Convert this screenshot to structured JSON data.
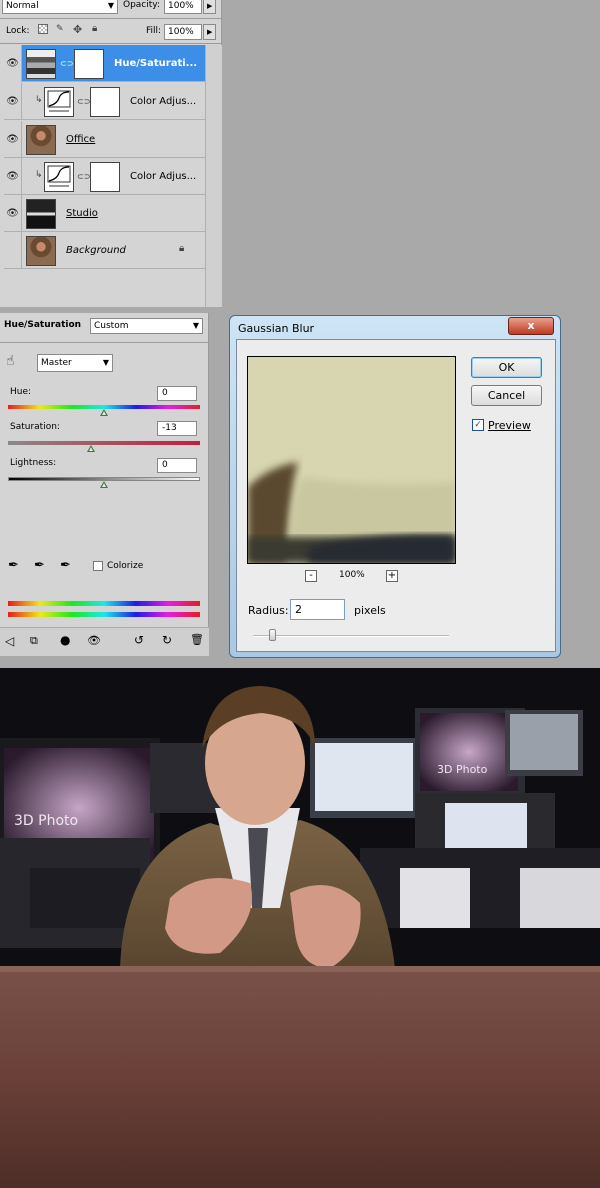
{
  "layers_panel": {
    "blend_mode": "Normal",
    "opacity_label": "Opacity:",
    "opacity_value": "100%",
    "lock_label": "Lock:",
    "fill_label": "Fill:",
    "fill_value": "100%",
    "layers": [
      {
        "name": "Hue/Saturati...",
        "selected": true
      },
      {
        "name": "Color Adjus..."
      },
      {
        "name": "Office"
      },
      {
        "name": "Color Adjus..."
      },
      {
        "name": "Studio"
      },
      {
        "name": "Background"
      }
    ]
  },
  "adjustments": {
    "title": "Hue/Saturation",
    "preset": "Custom",
    "channel": "Master",
    "hue_label": "Hue:",
    "hue_value": "0",
    "saturation_label": "Saturation:",
    "saturation_value": "-13",
    "lightness_label": "Lightness:",
    "lightness_value": "0",
    "colorize_label": "Colorize"
  },
  "gaussian_blur": {
    "title": "Gaussian Blur",
    "ok_label": "OK",
    "cancel_label": "Cancel",
    "preview_label": "Preview",
    "preview_checked": true,
    "zoom_minus": "-",
    "zoom_value": "100%",
    "zoom_plus": "+",
    "radius_label": "Radius:",
    "radius_value": "2",
    "radius_unit": "pixels",
    "close_glyph": "x"
  },
  "photo": {
    "screen_text_left": "3D Photo",
    "screen_text_right": "3D Photo"
  }
}
